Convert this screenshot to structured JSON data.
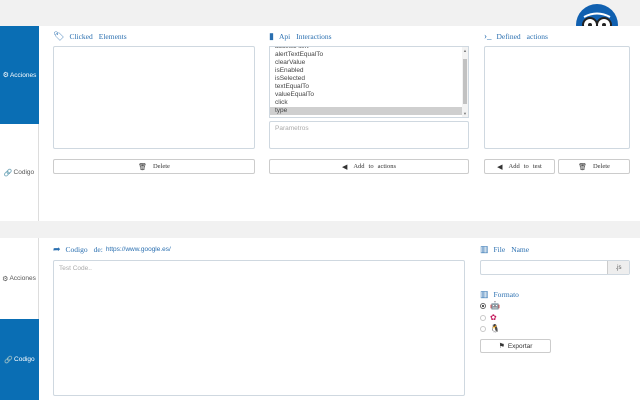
{
  "logo": {
    "icon": "glasses-face-icon",
    "color": "#1060b0"
  },
  "sidebar_top": {
    "acciones_label": "Acciones",
    "codigo_label": "Codigo"
  },
  "sidebar_bottom": {
    "acciones_label": "Acciones",
    "codigo_label": "Codigo"
  },
  "clicked": {
    "title_words": [
      "Clicked",
      "Elements"
    ],
    "delete_label": "Delete"
  },
  "api": {
    "title_words": [
      "Api",
      "Interactions"
    ],
    "items": [
      "accessAlert",
      "alertTextEqualTo",
      "clearValue",
      "isEnabled",
      "isSelected",
      "textEqualTo",
      "valueEqualTo",
      "click",
      "type"
    ],
    "selected": "type",
    "params_placeholder": "Parametros",
    "add_label_words": [
      "Add",
      "to",
      "actions"
    ]
  },
  "defined": {
    "title_words": [
      "Defined",
      "actions"
    ],
    "add_test_words": [
      "Add",
      "to",
      "test"
    ],
    "delete_label": "Delete"
  },
  "code": {
    "title_words": [
      "Codigo",
      "de:"
    ],
    "url": "https://www.google.es/",
    "placeholder": "Test Code.."
  },
  "file": {
    "title_words": [
      "File",
      "Name"
    ],
    "suffix": ".js",
    "value": ""
  },
  "format": {
    "title": "Formato",
    "options": [
      {
        "icon": "green-robot-icon",
        "checked": true
      },
      {
        "icon": "pink-flower-icon",
        "checked": false
      },
      {
        "icon": "penguin-icon",
        "checked": false
      }
    ],
    "export_label": "Exportar"
  },
  "colors": {
    "accent": "#0a6eb4",
    "header_text": "#2a6fb0"
  }
}
